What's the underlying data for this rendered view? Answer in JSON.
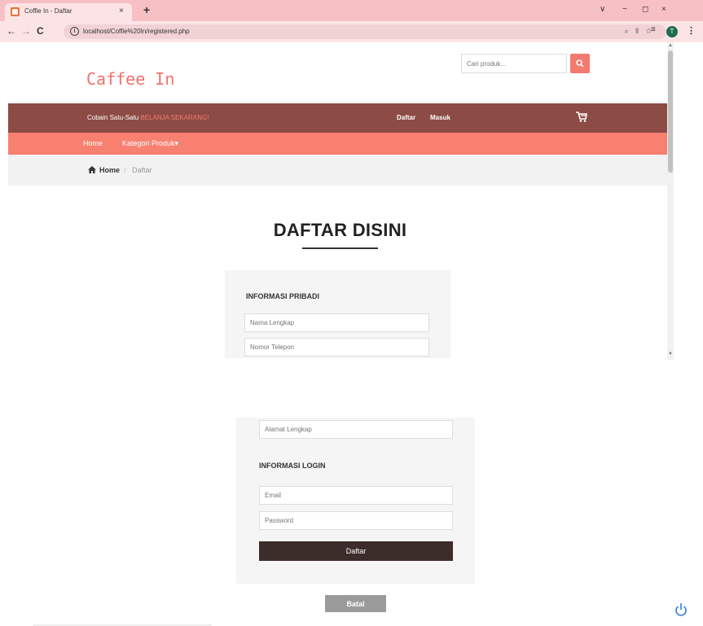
{
  "browser": {
    "tab_title": "Coffie In - Daftar",
    "tab_close": "×",
    "new_tab": "+",
    "url": "localhost/Coffie%20In/registered.php",
    "profile_initial": "T",
    "nav_back": "←",
    "nav_forward": "→",
    "nav_reload": "C",
    "win_dropdown": "∨",
    "win_minimize": "−",
    "win_maximize": "◻",
    "win_close": "×"
  },
  "header": {
    "logo": "Caffee In",
    "search_placeholder": "Cari produk..."
  },
  "topbar": {
    "promo_text": "Cobain Satu-Satu",
    "promo_highlight": "BELANJA SEKARANG!",
    "register_link": "Daftar",
    "login_link": "Masuk"
  },
  "nav": {
    "home": "Home",
    "categories": "Kategori Produk",
    "categories_caret": "▾"
  },
  "breadcrumb": {
    "home": "Home",
    "separator": "/",
    "current": "Daftar"
  },
  "page": {
    "title": "DAFTAR DISINI"
  },
  "form": {
    "personal_heading": "INFORMASI PRIBADI",
    "full_name_placeholder": "Nama Lengkap",
    "phone_placeholder": "Nomor Telepon",
    "address_placeholder": "Alamat Lengkap",
    "login_heading": "INFORMASI LOGIN",
    "email_placeholder": "Email",
    "password_placeholder": "Password",
    "submit_label": "Daftar",
    "cancel_label": "Batal"
  },
  "colors": {
    "brand": "#f0716b",
    "topbar": "#8c4b45",
    "navbar": "#f88070",
    "submit": "#3c2c2a",
    "cancel": "#9b9b9b"
  }
}
